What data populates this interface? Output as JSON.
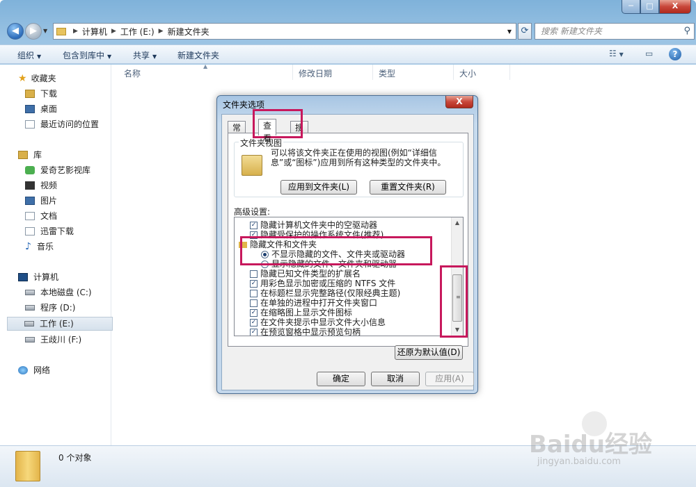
{
  "window": {
    "minimize": "─",
    "maximize": "□",
    "close": "X"
  },
  "address": {
    "segments": [
      "计算机",
      "工作 (E:)",
      "新建文件夹"
    ],
    "search_placeholder": "搜索 新建文件夹"
  },
  "toolbar": {
    "organize": "组织",
    "include_in_library": "包含到库中",
    "share": "共享",
    "new_folder": "新建文件夹"
  },
  "columns": [
    "名称",
    "修改日期",
    "类型",
    "大小"
  ],
  "nav": {
    "favorites": "收藏夹",
    "fav_items": [
      "下载",
      "桌面",
      "最近访问的位置"
    ],
    "libraries": "库",
    "lib_items": [
      "爱奇艺影视库",
      "视频",
      "图片",
      "文档",
      "迅雷下载",
      "音乐"
    ],
    "computer": "计算机",
    "drives": [
      "本地磁盘 (C:)",
      "程序 (D:)",
      "工作 (E:)",
      "王歧川 (F:)"
    ],
    "network": "网络"
  },
  "status": {
    "text": "0 个对象"
  },
  "watermark": {
    "logo": "Baidu经验",
    "url": "jingyan.baidu.com"
  },
  "dialog": {
    "title": "文件夹选项",
    "close": "X",
    "tabs": [
      "常规",
      "查看",
      "搜索"
    ],
    "group_title": "文件夹视图",
    "group_desc": "可以将该文件夹正在使用的视图(例如“详细信息”或“图标”)应用到所有这种类型的文件夹中。",
    "apply_to_folders": "应用到文件夹(L)",
    "reset_folders": "重置文件夹(R)",
    "advanced_label": "高级设置:",
    "advanced_items": [
      {
        "type": "checkbox",
        "checked": true,
        "label": "隐藏计算机文件夹中的空驱动器"
      },
      {
        "type": "checkbox",
        "checked": true,
        "label": "隐藏受保护的操作系统文件(推荐)"
      },
      {
        "type": "folder",
        "label": "隐藏文件和文件夹"
      },
      {
        "type": "radio",
        "checked": true,
        "label": "不显示隐藏的文件、文件夹或驱动器"
      },
      {
        "type": "radio",
        "checked": false,
        "label": "显示隐藏的文件、文件夹和驱动器"
      },
      {
        "type": "checkbox",
        "checked": false,
        "label": "隐藏已知文件类型的扩展名"
      },
      {
        "type": "checkbox",
        "checked": true,
        "label": "用彩色显示加密或压缩的 NTFS 文件"
      },
      {
        "type": "checkbox",
        "checked": false,
        "label": "在标题栏显示完整路径(仅限经典主题)"
      },
      {
        "type": "checkbox",
        "checked": false,
        "label": "在单独的进程中打开文件夹窗口"
      },
      {
        "type": "checkbox",
        "checked": true,
        "label": "在缩略图上显示文件图标"
      },
      {
        "type": "checkbox",
        "checked": true,
        "label": "在文件夹提示中显示文件大小信息"
      },
      {
        "type": "checkbox",
        "checked": true,
        "label": "在预览窗格中显示预览句柄"
      }
    ],
    "restore_defaults": "还原为默认值(D)",
    "ok": "确定",
    "cancel": "取消",
    "apply": "应用(A)"
  },
  "colors": {
    "highlight": "#c7185c",
    "frame": "#9cc4e4"
  }
}
